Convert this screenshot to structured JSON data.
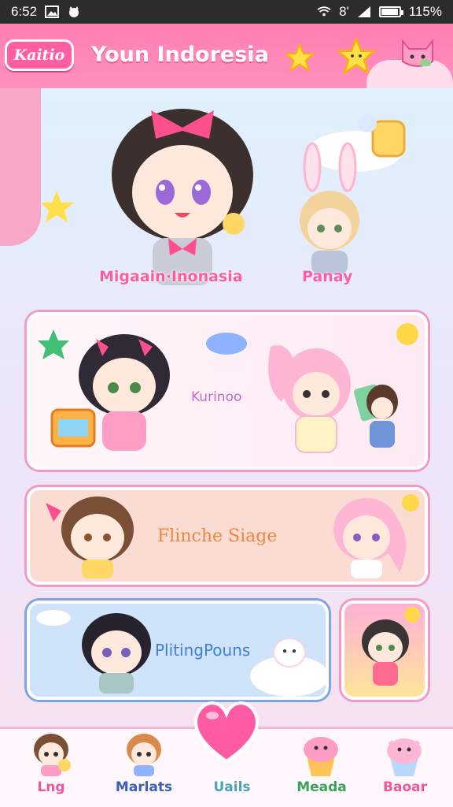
{
  "status_bar": {
    "time": "6:52",
    "network": "8'",
    "battery": "115%",
    "battery_level": 0.95
  },
  "header": {
    "logo_text": "Kaitio",
    "title": "Youn Indoresia",
    "icons": [
      "star-icon",
      "star-icon",
      "cat-icon"
    ]
  },
  "hero": {
    "left_caption": "Migaain·Inonasia",
    "right_caption": "Panay"
  },
  "cards": {
    "card1": {
      "label": "Kurinoo"
    },
    "card2": {
      "label": "Flinche Siage"
    },
    "card3": {
      "label": "PlitingPouns"
    }
  },
  "bottom_nav": {
    "items": [
      {
        "label": "Lng",
        "color": "#e95a9b",
        "icon": "girl-icon"
      },
      {
        "label": "Marlats",
        "color": "#3a5fb8",
        "icon": "girl-icon"
      },
      {
        "label": "Uails",
        "color": "#4aa3b3",
        "icon": "heart-icon"
      },
      {
        "label": "Meada",
        "color": "#3aa35a",
        "icon": "cupcake-icon"
      },
      {
        "label": "Baoar",
        "color": "#e95a9b",
        "icon": "cupcake-icon"
      }
    ]
  },
  "colors": {
    "header_pink": "#ff7fb3",
    "accent_pink": "#ff5ca6",
    "card_border": "#f49ac1"
  }
}
